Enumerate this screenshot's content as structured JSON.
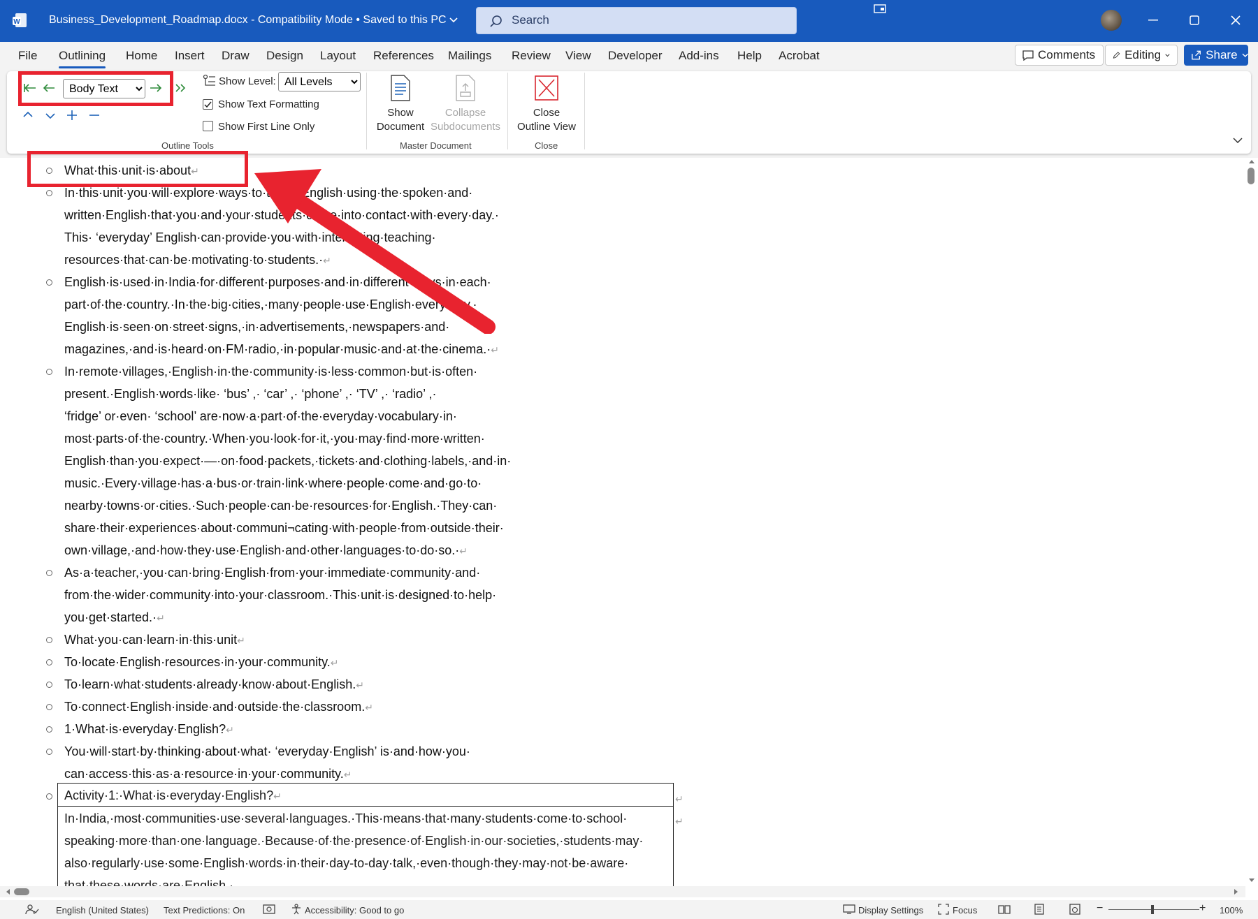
{
  "app": {
    "doc_title": "Business_Development_Roadmap.docx",
    "mode": "Compatibility Mode",
    "save_state": "Saved to this PC",
    "search_placeholder": "Search"
  },
  "tabs": [
    "File",
    "Outlining",
    "Home",
    "Insert",
    "Draw",
    "Design",
    "Layout",
    "References",
    "Mailings",
    "Review",
    "View",
    "Developer",
    "Add-ins",
    "Help",
    "Acrobat"
  ],
  "active_tab": "Outlining",
  "header_buttons": {
    "comments": "Comments",
    "editing": "Editing",
    "share": "Share"
  },
  "ribbon": {
    "outline_level": "Body Text",
    "show_level_label": "Show Level:",
    "show_level_value": "All Levels",
    "show_text_formatting": "Show Text Formatting",
    "show_text_formatting_checked": true,
    "show_first_line_only": "Show First Line Only",
    "show_first_line_only_checked": false,
    "show_document_1": "Show",
    "show_document_2": "Document",
    "collapse_1": "Collapse",
    "collapse_2": "Subdocuments",
    "close_1": "Close",
    "close_2": "Outline View",
    "group_outline_tools": "Outline Tools",
    "group_master_document": "Master Document",
    "group_close": "Close"
  },
  "document": {
    "paragraphs": [
      [
        "What·this·unit·is·about"
      ],
      [
        "In·this·unit·you·will·explore·ways·to·teach·English·using·the·spoken·and·",
        "written·English·that·you·and·your·students·come·into·contact·with·every·day.·",
        "This·   ‘everyday’   English·can·provide·you·with·interesting·teaching·",
        "resources·that·can·be·motivating·to·students.·"
      ],
      [
        "English·is·used·in·India·for·different·purposes·and·in·different·ways·in·each·",
        "part·of·the·country.·In·the·big·cities,·many·people·use·English·every·day.·",
        "English·is·seen·on·street·signs,·in·advertisements,·newspapers·and·",
        "magazines,·and·is·heard·on·FM·radio,·in·popular·music·and·at·the·cinema.·"
      ],
      [
        "In·remote·villages,·English·in·the·community·is·less·common·but·is·often·",
        "present.·English·words·like·   ‘bus’   ,·   ‘car’   ,·   ‘phone’   ,·   ‘TV’   ,·   ‘radio’   ,·",
        "   ‘fridge’   or·even·   ‘school’   are·now·a·part·of·the·everyday·vocabulary·in·",
        "most·parts·of·the·country.·When·you·look·for·it,·you·may·find·more·written·",
        "English·than·you·expect·—·on·food·packets,·tickets·and·clothing·labels,·and·in·",
        "music.·Every·village·has·a·bus·or·train·link·where·people·come·and·go·to·",
        "nearby·towns·or·cities.·Such·people·can·be·resources·for·English.·They·can·",
        "share·their·experiences·about·communi¬cating·with·people·from·outside·their·",
        "own·village,·and·how·they·use·English·and·other·languages·to·do·so.·"
      ],
      [
        "As·a·teacher,·you·can·bring·English·from·your·immediate·community·and·",
        "from·the·wider·community·into·your·classroom.·This·unit·is·designed·to·help·",
        "you·get·started.·"
      ],
      [
        "What·you·can·learn·in·this·unit"
      ],
      [
        "To·locate·English·resources·in·your·community."
      ],
      [
        "To·learn·what·students·already·know·about·English."
      ],
      [
        "To·connect·English·inside·and·outside·the·classroom."
      ],
      [
        "1·What·is·everyday·English?"
      ],
      [
        "You·will·start·by·thinking·about·what·   ‘everyday·English’   is·and·how·you·",
        "can·access·this·as·a·resource·in·your·community."
      ]
    ],
    "table_title": "Activity·1:·What·is·everyday·English?",
    "table_body": [
      "In·India,·most·communities·use·several·languages.·This·means·that·many·students·come·to·school·",
      "speaking·more·than·one·language.·Because·of·the·presence·of·English·in·our·societies,·students·may·",
      "also·regularly·use·some·English·words·in·their·day-to-day·talk,·even·though·they·may·not·be·aware·",
      "that·these·words·are·English.·"
    ]
  },
  "status": {
    "language": "English (United States)",
    "predictions": "Text Predictions: On",
    "accessibility": "Accessibility: Good to go",
    "display": "Display Settings",
    "focus": "Focus",
    "zoom": "100%"
  },
  "colors": {
    "title_bar": "#185abd",
    "highlight": "#e8232f"
  }
}
